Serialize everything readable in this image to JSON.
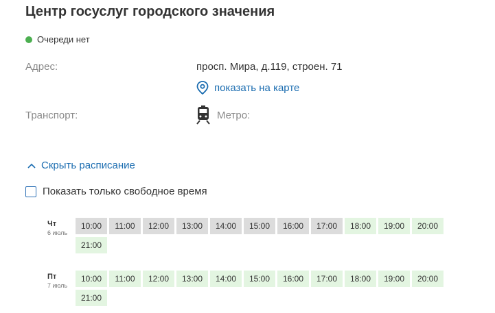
{
  "title": "Центр госуслуг городского значения",
  "queue_status": "Очереди нет",
  "address_label": "Адрес:",
  "address_value": "просп. Мира, д.119, строен. 71",
  "map_link": "показать на карте",
  "transport_label": "Транспорт:",
  "metro_label": "Метро:",
  "schedule_toggle": "Скрыть расписание",
  "free_only_label": "Показать только свободное время",
  "colors": {
    "accent": "#1a6cb0",
    "status_green": "#4caf50",
    "busy": "#dcdcdc",
    "free": "#e3f5e1"
  },
  "days": [
    {
      "day": "Чт",
      "date": "6 июль",
      "slots": [
        {
          "time": "10:00",
          "state": "busy"
        },
        {
          "time": "11:00",
          "state": "busy"
        },
        {
          "time": "12:00",
          "state": "busy"
        },
        {
          "time": "13:00",
          "state": "busy"
        },
        {
          "time": "14:00",
          "state": "busy"
        },
        {
          "time": "15:00",
          "state": "busy"
        },
        {
          "time": "16:00",
          "state": "busy"
        },
        {
          "time": "17:00",
          "state": "busy"
        },
        {
          "time": "18:00",
          "state": "free"
        },
        {
          "time": "19:00",
          "state": "free"
        },
        {
          "time": "20:00",
          "state": "free"
        },
        {
          "time": "21:00",
          "state": "free"
        }
      ]
    },
    {
      "day": "Пт",
      "date": "7 июль",
      "slots": [
        {
          "time": "10:00",
          "state": "free"
        },
        {
          "time": "11:00",
          "state": "free"
        },
        {
          "time": "12:00",
          "state": "free"
        },
        {
          "time": "13:00",
          "state": "free"
        },
        {
          "time": "14:00",
          "state": "free"
        },
        {
          "time": "15:00",
          "state": "free"
        },
        {
          "time": "16:00",
          "state": "free"
        },
        {
          "time": "17:00",
          "state": "free"
        },
        {
          "time": "18:00",
          "state": "free"
        },
        {
          "time": "19:00",
          "state": "free"
        },
        {
          "time": "20:00",
          "state": "free"
        },
        {
          "time": "21:00",
          "state": "free"
        }
      ]
    }
  ]
}
